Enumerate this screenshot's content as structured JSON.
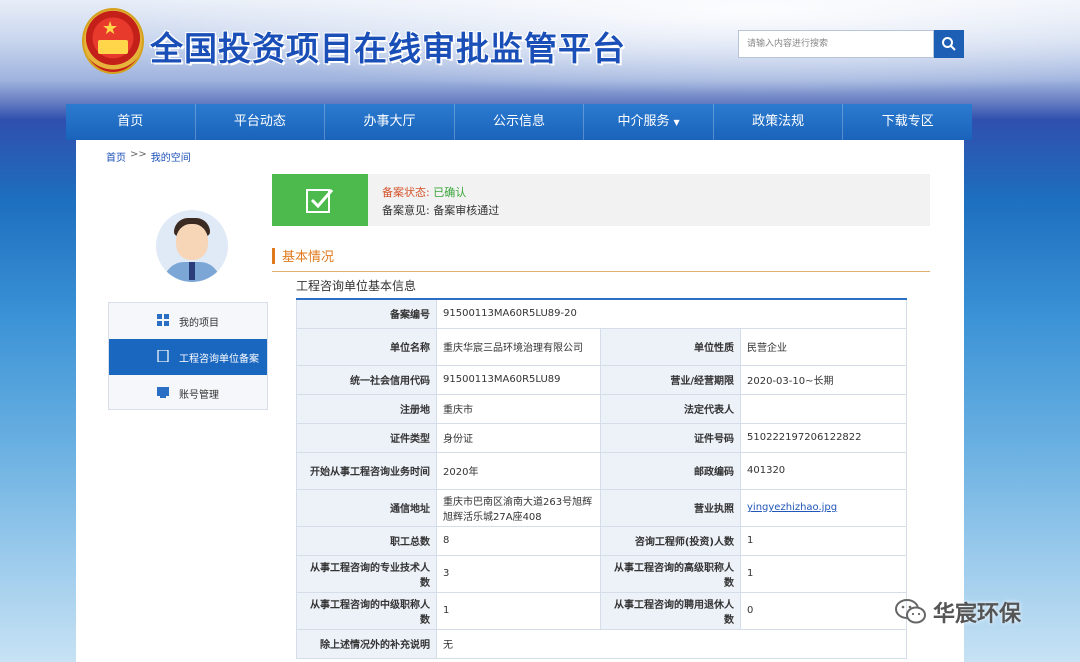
{
  "header": {
    "title": "全国投资项目在线审批监管平台",
    "search_placeholder": "请输入内容进行搜索"
  },
  "nav": {
    "items": [
      "首页",
      "平台动态",
      "办事大厅",
      "公示信息",
      "中介服务",
      "政策法规",
      "下载专区"
    ],
    "caret": "▼"
  },
  "breadcrumb": {
    "home": "首页",
    "sep": ">>",
    "current": "我的空间"
  },
  "sidebar": {
    "items": [
      {
        "label": "我的项目"
      },
      {
        "label": "工程咨询单位备案"
      },
      {
        "label": "账号管理"
      }
    ]
  },
  "status": {
    "state_label": "备案状态:",
    "state_value": "已确认",
    "opinion_label": "备案意见:",
    "opinion_value": "备案审核通过"
  },
  "section": {
    "title": "基本情况",
    "subtitle": "工程咨询单位基本信息"
  },
  "table": {
    "r1": {
      "l1": "备案编号",
      "v1": "91500113MA60R5LU89-20"
    },
    "r2": {
      "l1": "单位名称",
      "v1": "重庆华宸三品环境治理有限公司",
      "l2": "单位性质",
      "v2": "民营企业"
    },
    "r3": {
      "l1": "统一社会信用代码",
      "v1": "91500113MA60R5LU89",
      "l2": "营业/经营期限",
      "v2": "2020-03-10~长期"
    },
    "r4": {
      "l1": "注册地",
      "v1": "重庆市",
      "l2": "法定代表人",
      "v2": ""
    },
    "r5": {
      "l1": "证件类型",
      "v1": "身份证",
      "l2": "证件号码",
      "v2": "510222197206122822"
    },
    "r6": {
      "l1": "开始从事工程咨询业务时间",
      "v1": "2020年",
      "l2": "邮政编码",
      "v2": "401320"
    },
    "r7": {
      "l1": "通信地址",
      "v1": "重庆市巴南区渝南大道263号旭辉旭辉活乐城27A座408",
      "l2": "营业执照",
      "v2": "yingyezhizhao.jpg"
    },
    "r8": {
      "l1": "职工总数",
      "v1": "8",
      "l2": "咨询工程师(投资)人数",
      "v2": "1"
    },
    "r9": {
      "l1": "从事工程咨询的专业技术人数",
      "v1": "3",
      "l2": "从事工程咨询的高级职称人数",
      "v2": "1"
    },
    "r10": {
      "l1": "从事工程咨询的中级职称人数",
      "v1": "1",
      "l2": "从事工程咨询的聘用退休人数",
      "v2": "0"
    },
    "r11": {
      "l1": "除上述情况外的补充说明",
      "v1": "无"
    }
  },
  "watermark": {
    "text": "华宸环保"
  }
}
